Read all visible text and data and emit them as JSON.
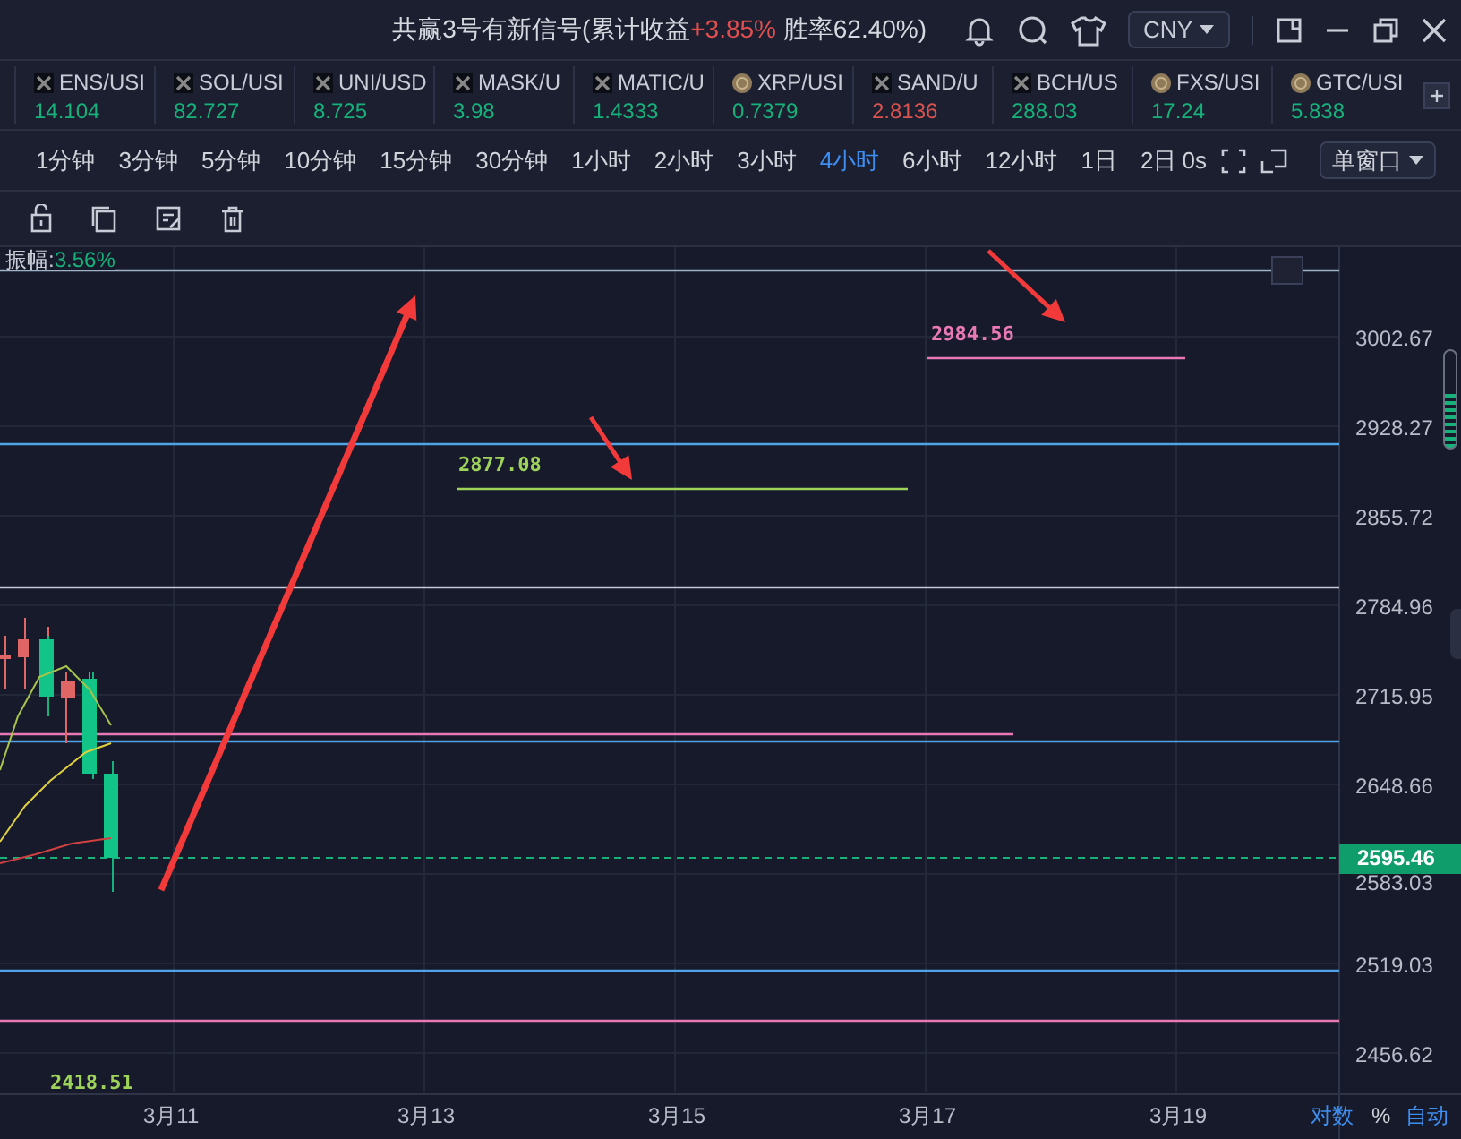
{
  "header": {
    "title": "共赢3号有新信号(累计收益",
    "gain": "+3.85%",
    "win_rate": "胜率62.40%)",
    "currency": "CNY"
  },
  "tickers": [
    {
      "symbol": "ENS/USI",
      "price": "14.104",
      "kind": "generic",
      "color": "#17b27a"
    },
    {
      "symbol": "SOL/USI",
      "price": "82.727",
      "kind": "generic",
      "color": "#17b27a"
    },
    {
      "symbol": "UNI/USD",
      "price": "8.725",
      "kind": "generic",
      "color": "#17b27a"
    },
    {
      "symbol": "MASK/U",
      "price": "3.98",
      "kind": "generic",
      "color": "#17b27a"
    },
    {
      "symbol": "MATIC/U",
      "price": "1.4333",
      "kind": "generic",
      "color": "#17b27a"
    },
    {
      "symbol": "XRP/USI",
      "price": "0.7379",
      "kind": "coin",
      "color": "#17b27a"
    },
    {
      "symbol": "SAND/U",
      "price": "2.8136",
      "kind": "generic",
      "color": "#d9534f"
    },
    {
      "symbol": "BCH/US",
      "price": "288.03",
      "kind": "generic",
      "color": "#17b27a"
    },
    {
      "symbol": "FXS/USI",
      "price": "17.24",
      "kind": "coin",
      "color": "#17b27a"
    },
    {
      "symbol": "GTC/USI",
      "price": "5.838",
      "kind": "coin",
      "color": "#17b27a"
    }
  ],
  "timeframes": [
    {
      "label": "1分钟",
      "selected": false
    },
    {
      "label": "3分钟",
      "selected": false
    },
    {
      "label": "5分钟",
      "selected": false
    },
    {
      "label": "10分钟",
      "selected": false
    },
    {
      "label": "15分钟",
      "selected": false
    },
    {
      "label": "30分钟",
      "selected": false
    },
    {
      "label": "1小时",
      "selected": false
    },
    {
      "label": "2小时",
      "selected": false
    },
    {
      "label": "3小时",
      "selected": false
    },
    {
      "label": "4小时",
      "selected": true
    },
    {
      "label": "6小时",
      "selected": false
    },
    {
      "label": "12小时",
      "selected": false
    },
    {
      "label": "1日",
      "selected": false
    },
    {
      "label": "2日",
      "selected": false
    }
  ],
  "countdown": "0s",
  "window_mode": "单窗口",
  "chart": {
    "amplitude_label": "振幅:",
    "amplitude": "3.56%",
    "price_axis": [
      "3002.67",
      "2928.27",
      "2855.72",
      "2784.96",
      "2715.95",
      "2648.66",
      "2583.03",
      "2519.03",
      "2456.62"
    ],
    "current_price": "2595.46",
    "level_labels": [
      {
        "text": "2984.56",
        "color": "#e879b4"
      },
      {
        "text": "2877.08",
        "color": "#9ed35a"
      },
      {
        "text": "2418.51",
        "color": "#9ed35a"
      }
    ],
    "dates": [
      "3月11",
      "3月13",
      "3月15",
      "3月17",
      "3月19"
    ]
  },
  "footer": {
    "log": "对数",
    "percent": "%",
    "auto": "自动"
  }
}
